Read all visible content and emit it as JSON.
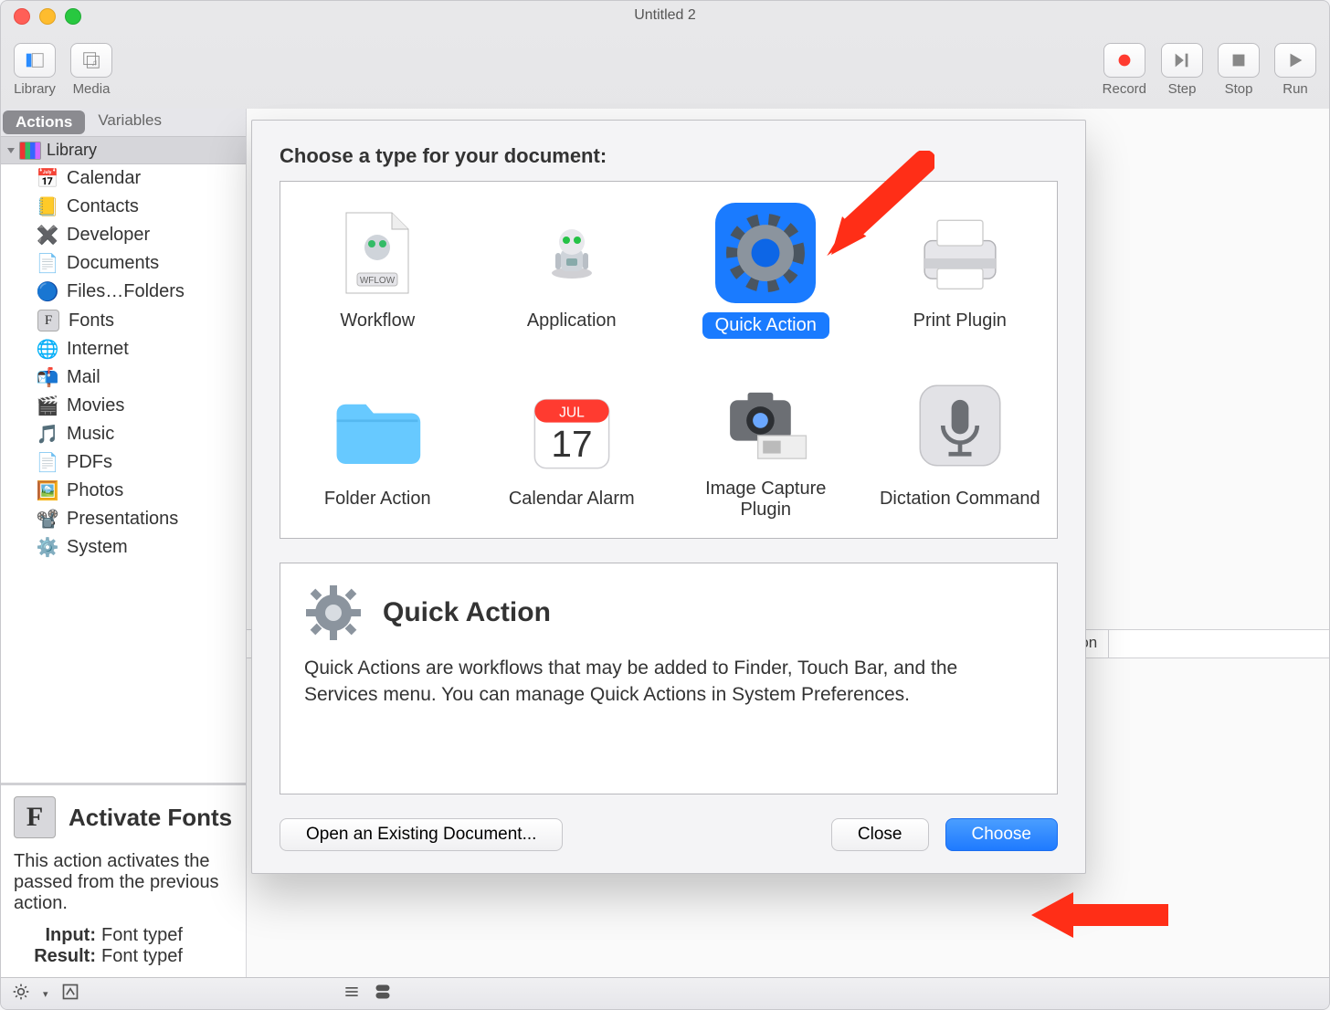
{
  "window": {
    "title": "Untitled 2"
  },
  "toolbar": {
    "left": [
      {
        "name": "library-button",
        "label": "Library"
      },
      {
        "name": "media-button",
        "label": "Media"
      }
    ],
    "right": [
      {
        "name": "record-button",
        "label": "Record"
      },
      {
        "name": "step-button",
        "label": "Step"
      },
      {
        "name": "stop-button",
        "label": "Stop"
      },
      {
        "name": "run-button",
        "label": "Run"
      }
    ]
  },
  "sidebar": {
    "tabs": [
      {
        "name": "actions-tab",
        "label": "Actions",
        "active": true
      },
      {
        "name": "variables-tab",
        "label": "Variables",
        "active": false
      }
    ],
    "header": "Library",
    "items": [
      {
        "label": "Calendar",
        "icon": "calendar-icon"
      },
      {
        "label": "Contacts",
        "icon": "contacts-icon"
      },
      {
        "label": "Developer",
        "icon": "developer-icon"
      },
      {
        "label": "Documents",
        "icon": "documents-icon"
      },
      {
        "label": "Files…Folders",
        "icon": "finder-icon"
      },
      {
        "label": "Fonts",
        "icon": "fonts-icon"
      },
      {
        "label": "Internet",
        "icon": "internet-icon"
      },
      {
        "label": "Mail",
        "icon": "mail-icon"
      },
      {
        "label": "Movies",
        "icon": "movies-icon"
      },
      {
        "label": "Music",
        "icon": "music-icon"
      },
      {
        "label": "PDFs",
        "icon": "pdfs-icon"
      },
      {
        "label": "Photos",
        "icon": "photos-icon"
      },
      {
        "label": "Presentations",
        "icon": "presentations-icon"
      },
      {
        "label": "System",
        "icon": "system-icon"
      }
    ]
  },
  "detail": {
    "title": "Activate Fonts",
    "desc": "This action activates the passed from the previous action.",
    "input_label": "Input:",
    "input_value": "Font typef",
    "result_label": "Result:",
    "result_value": "Font typef"
  },
  "log": {
    "col1": "",
    "col2": "Duration"
  },
  "dialog": {
    "heading": "Choose a type for your document:",
    "types": [
      {
        "name": "workflow",
        "label": "Workflow",
        "selected": false
      },
      {
        "name": "application",
        "label": "Application",
        "selected": false
      },
      {
        "name": "quick-action",
        "label": "Quick Action",
        "selected": true
      },
      {
        "name": "print-plugin",
        "label": "Print Plugin",
        "selected": false
      },
      {
        "name": "folder-action",
        "label": "Folder Action",
        "selected": false
      },
      {
        "name": "calendar-alarm",
        "label": "Calendar Alarm",
        "selected": false
      },
      {
        "name": "image-capture-plugin",
        "label": "Image Capture Plugin",
        "selected": false
      },
      {
        "name": "dictation-command",
        "label": "Dictation Command",
        "selected": false
      }
    ],
    "info_title": "Quick Action",
    "info_body": "Quick Actions are workflows that may be added to Finder, Touch Bar, and the Services menu. You can manage Quick Actions in System Preferences.",
    "open_button": "Open an Existing Document...",
    "close_button": "Close",
    "choose_button": "Choose"
  },
  "calendar_day": "17",
  "calendar_month": "JUL"
}
